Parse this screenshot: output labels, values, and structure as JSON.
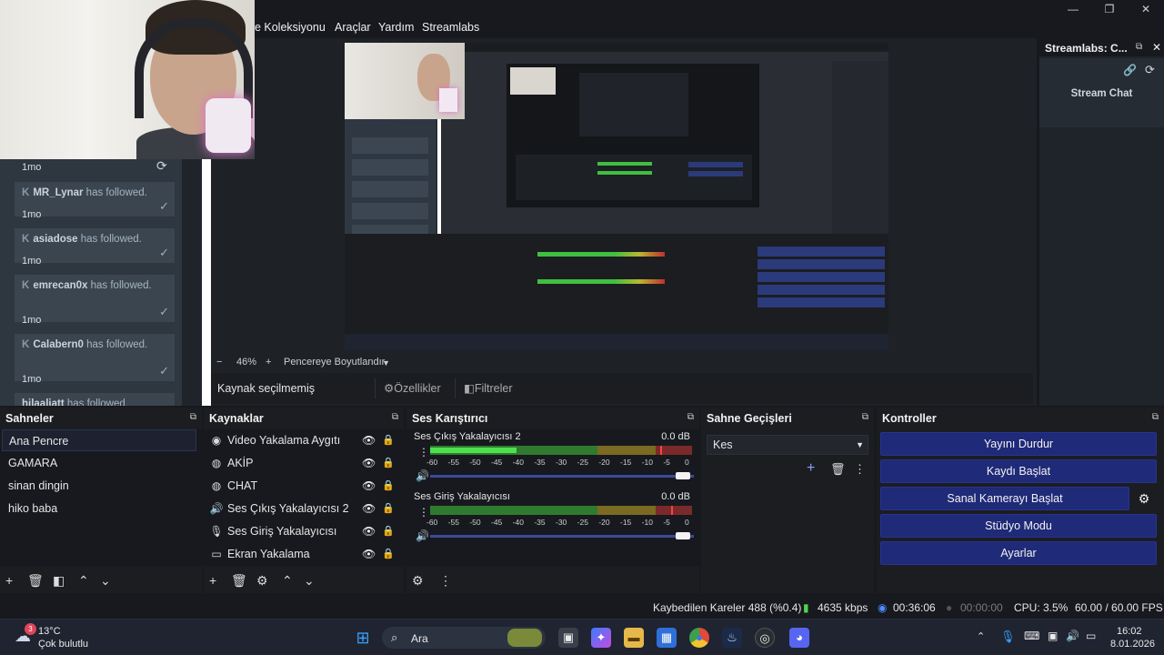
{
  "menu": {
    "items": [
      "ne Koleksiyonu",
      "Araçlar",
      "Yardım",
      "Streamlabs"
    ]
  },
  "window_controls": [
    "—",
    "❐",
    "✕"
  ],
  "chat": {
    "age_top": "1mo",
    "entries": [
      {
        "name": "MR_Lynar",
        "suffix": " has followed.",
        "age": "1mo"
      },
      {
        "name": "asiadose",
        "suffix": " has followed.",
        "age": "1mo"
      },
      {
        "name": "emrecan0x",
        "suffix": " has followed.",
        "age": "1mo"
      },
      {
        "name": "Calabern0",
        "suffix": " has followed.",
        "age": "1mo"
      },
      {
        "name": "hilaaliatt",
        "suffix": " has followed.",
        "age": ""
      }
    ]
  },
  "preview": {
    "zoom": "46%",
    "fit_label": "Pencereye Boyutlandır",
    "no_source": "Kaynak seçilmemiş",
    "properties": "Özellikler",
    "filters": "Filtreler"
  },
  "streamlabs_panel": {
    "title": "Streamlabs: C...",
    "tab": "Stream Chat"
  },
  "scenes": {
    "title": "Sahneler",
    "items": [
      "Ana Pencre",
      "GAMARA",
      "sinan dingin",
      "hiko baba"
    ],
    "selected": 0
  },
  "sources": {
    "title": "Kaynaklar",
    "items": [
      {
        "label": "Video Yakalama Aygıtı",
        "icon": "camera-icon"
      },
      {
        "label": "AKİP",
        "icon": "globe-icon"
      },
      {
        "label": "CHAT",
        "icon": "globe-icon"
      },
      {
        "label": "Ses Çıkış Yakalayıcısı 2",
        "icon": "speaker-icon"
      },
      {
        "label": "Ses Giriş Yakalayıcısı",
        "icon": "microphone-icon"
      },
      {
        "label": "Ekran Yakalama",
        "icon": "monitor-icon"
      }
    ]
  },
  "mixer": {
    "title": "Ses Karıştırıcı",
    "ticks": [
      "-60",
      "-55",
      "-50",
      "-45",
      "-40",
      "-35",
      "-30",
      "-25",
      "-20",
      "-15",
      "-10",
      "-5",
      "0"
    ],
    "channels": [
      {
        "name": "Ses Çıkış Yakalayıcısı 2",
        "db": "0.0 dB",
        "level": 0.33,
        "peak": 0.88
      },
      {
        "name": "Ses Giriş Yakalayıcısı",
        "db": "0.0 dB",
        "level": 0.0,
        "peak": 0.92
      }
    ]
  },
  "transitions": {
    "title": "Sahne Geçişleri",
    "selected": "Kes"
  },
  "controls": {
    "title": "Kontroller",
    "stop_stream": "Yayını Durdur",
    "start_recording": "Kaydı Başlat",
    "start_virtual_cam": "Sanal Kamerayı Başlat",
    "studio_mode": "Stüdyo Modu",
    "settings": "Ayarlar"
  },
  "status": {
    "dropped": "Kaybedilen Kareler 488 (%0.4)",
    "bitrate": "4635 kbps",
    "stream_time": "00:36:06",
    "rec_time": "00:00:00",
    "cpu": "CPU: 3.5%",
    "fps": "60.00 / 60.00 FPS"
  },
  "taskbar": {
    "weather_temp": "13°C",
    "weather_desc": "Çok bulutlu",
    "weather_badge": "3",
    "search": "Ara",
    "time": "16:02",
    "date": "8.01.2026"
  },
  "colors": {
    "accent_button": "#1f2a78",
    "meter_green": "#4ee04e",
    "meter_peak": "#ff4040"
  }
}
